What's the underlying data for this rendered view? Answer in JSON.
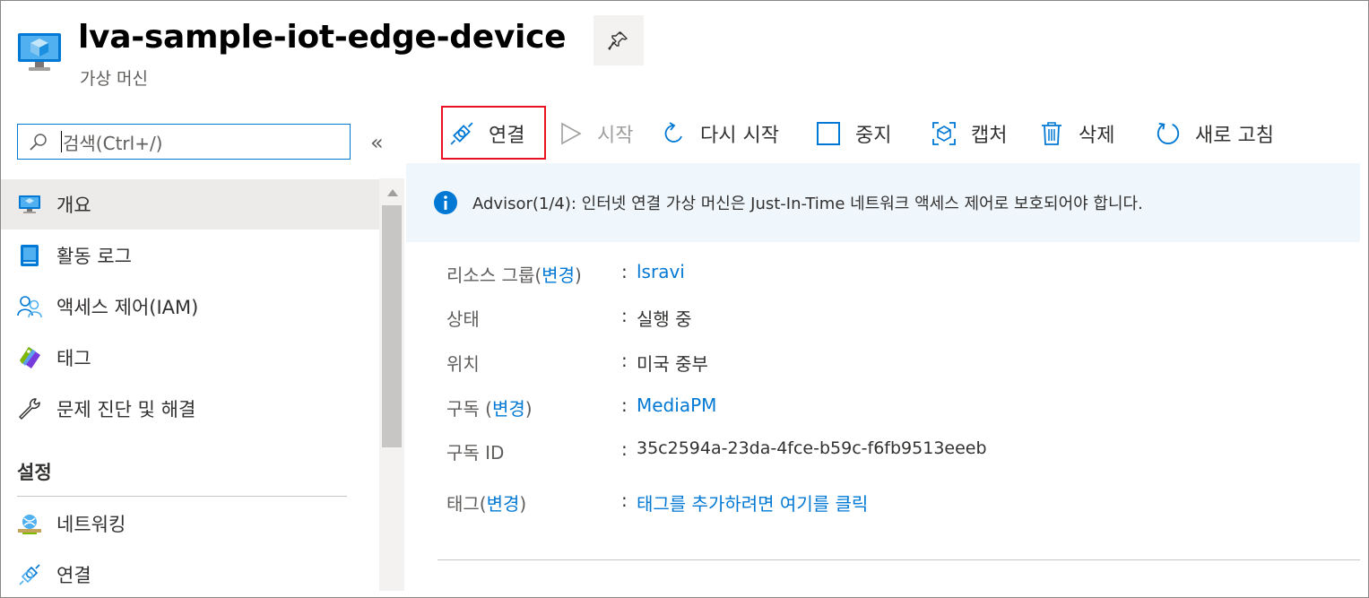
{
  "header": {
    "title": "lva-sample-iot-edge-device",
    "subtitle": "가상 머신",
    "icon": "vm-icon",
    "pin_icon": "pin-icon"
  },
  "sidebar": {
    "search_placeholder": "검색(Ctrl+/)",
    "collapse_label": "«",
    "items": [
      {
        "label": "개요",
        "icon": "vm-overview-icon",
        "selected": true
      },
      {
        "label": "활동 로그",
        "icon": "activity-log-icon"
      },
      {
        "label": "액세스 제어(IAM)",
        "icon": "people-icon"
      },
      {
        "label": "태그",
        "icon": "tag-icon"
      },
      {
        "label": "문제 진단 및 해결",
        "icon": "wrench-icon"
      }
    ],
    "section_title": "설정",
    "settings_items": [
      {
        "label": "네트워킹",
        "icon": "networking-icon"
      },
      {
        "label": "연결",
        "icon": "connect-icon"
      }
    ]
  },
  "toolbar": {
    "connect": "연결",
    "start": "시작",
    "restart": "다시 시작",
    "stop": "중지",
    "capture": "캡처",
    "delete": "삭제",
    "refresh": "새로 고침"
  },
  "advisor": {
    "text": "Advisor(1/4): 인터넷 연결 가상 머신은 Just-In-Time 네트워크 액세스 제어로 보호되어야 합니다."
  },
  "properties": {
    "resource_group": {
      "label_prefix": "리소스 그룹(",
      "label_link": "변경",
      "label_suffix": ")",
      "value": "lsravi"
    },
    "status": {
      "label": "상태",
      "value": "실행 중"
    },
    "location": {
      "label": "위치",
      "value": "미국 중부"
    },
    "subscription": {
      "label_prefix": "구독 (",
      "label_link": "변경",
      "label_suffix": ")",
      "value": "MediaPM"
    },
    "subscription_id": {
      "label": "구독 ID",
      "value": "35c2594a-23da-4fce-b59c-f6fb9513eeeb"
    },
    "tags": {
      "label_prefix": "태그(",
      "label_link": "변경",
      "label_suffix": ")",
      "value": "태그를 추가하려면 여기를 클릭"
    }
  },
  "colors": {
    "accent": "#0078d4",
    "highlight_border": "#e81123",
    "banner_bg": "#eff6fc"
  }
}
